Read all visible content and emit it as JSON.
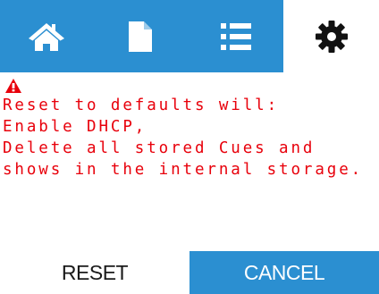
{
  "tabs": [
    {
      "id": "home",
      "icon": "home-icon",
      "active": false
    },
    {
      "id": "file",
      "icon": "file-icon",
      "active": false
    },
    {
      "id": "list",
      "icon": "list-icon",
      "active": false
    },
    {
      "id": "settings",
      "icon": "gear-icon",
      "active": true
    }
  ],
  "message": {
    "icon": "warning-icon",
    "lines": [
      "Reset to defaults will:",
      "Enable DHCP,",
      "Delete all stored Cues and",
      "shows in the internal storage."
    ]
  },
  "buttons": {
    "reset_label": "RESET",
    "cancel_label": "CANCEL"
  },
  "colors": {
    "accent": "#2b8fd1",
    "warning": "#e8000b",
    "background": "#ffffff"
  }
}
